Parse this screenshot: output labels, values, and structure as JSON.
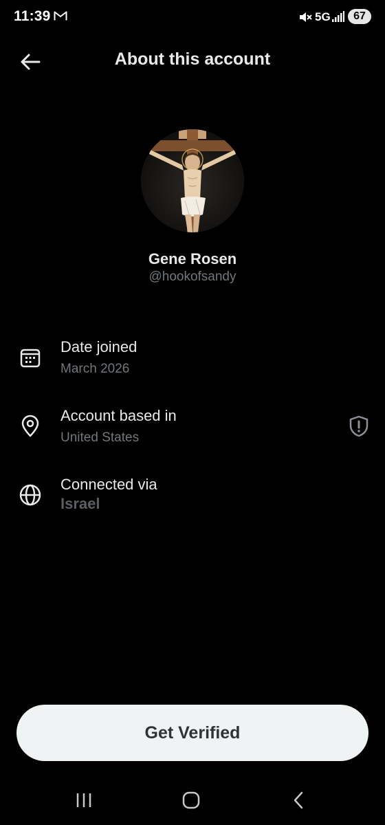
{
  "status_bar": {
    "time": "11:39",
    "network": "5G",
    "battery": "67",
    "icons": [
      "gmail-icon",
      "mute-icon",
      "signal-icon"
    ]
  },
  "header": {
    "title": "About this account",
    "back_icon": "arrow-left-icon"
  },
  "profile": {
    "name": "Gene Rosen",
    "handle": "@hookofsandy"
  },
  "details": [
    {
      "icon": "calendar-icon",
      "label": "Date joined",
      "value": "March 2026"
    },
    {
      "icon": "location-pin-icon",
      "label": "Account based in",
      "value": "United States",
      "trailing_icon": "shield-alert-icon"
    },
    {
      "icon": "globe-icon",
      "label": "Connected via",
      "value": "Israel"
    }
  ],
  "actions": {
    "get_verified_label": "Get Verified"
  },
  "nav_bar": {
    "icons": [
      "recents-icon",
      "home-icon",
      "back-icon"
    ]
  },
  "colors": {
    "background": "#000000",
    "primary_text": "#e7e9ea",
    "secondary_text": "#71767b",
    "button_bg": "#eff3f4",
    "button_text": "#2f3336"
  }
}
